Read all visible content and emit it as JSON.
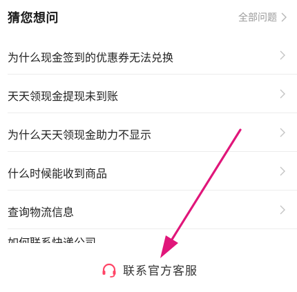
{
  "header": {
    "title": "猜您想问",
    "all_link": "全部问题"
  },
  "questions": [
    {
      "label": "为什么现金签到的优惠券无法兑换"
    },
    {
      "label": "天天领现金提现未到账"
    },
    {
      "label": "为什么天天领现金助力不显示"
    },
    {
      "label": "什么时候能收到商品"
    },
    {
      "label": "查询物流信息"
    },
    {
      "label": "如何联系快递公司"
    }
  ],
  "footer": {
    "contact_label": "联系官方客服",
    "headset_icon": "headset-icon",
    "accent": "#ff4466"
  },
  "annotation": {
    "arrow_color": "#e0167a"
  }
}
